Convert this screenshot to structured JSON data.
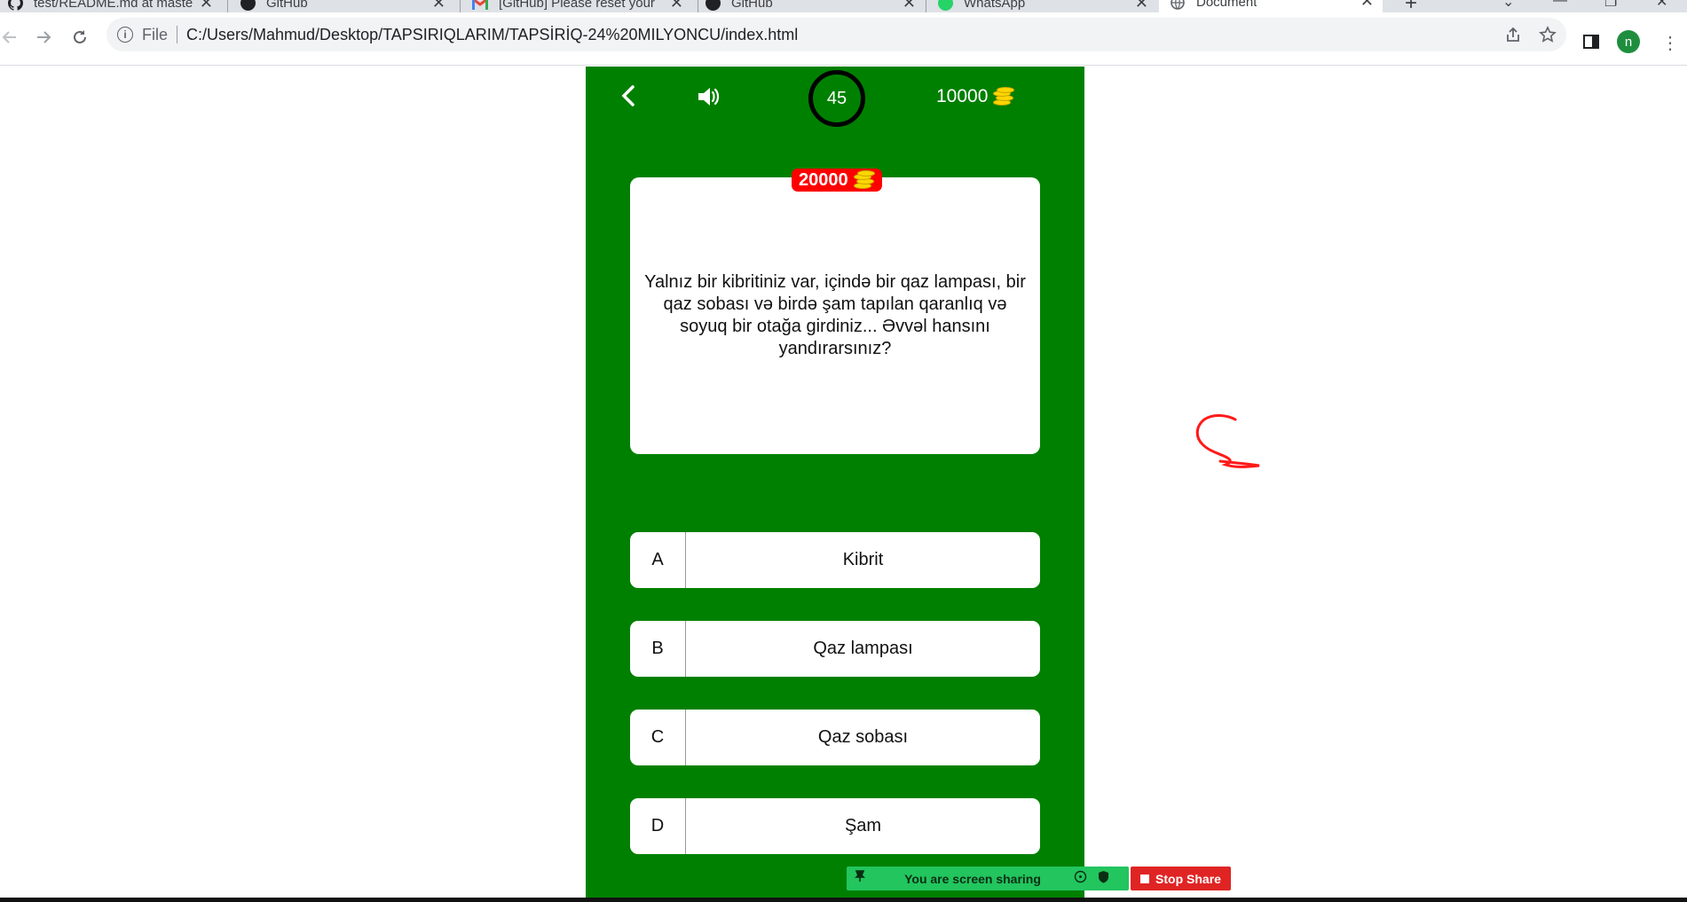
{
  "browser": {
    "tabs": [
      {
        "title": "test/README.md at master",
        "icon": "github-icon"
      },
      {
        "title": "GitHub",
        "icon": "github-icon"
      },
      {
        "title": "[GitHub] Please reset your p",
        "icon": "gmail-icon"
      },
      {
        "title": "GitHub",
        "icon": "github-icon"
      },
      {
        "title": "WhatsApp",
        "icon": "whatsapp-icon"
      },
      {
        "title": "Document",
        "icon": "globe-icon",
        "active": true
      }
    ],
    "address": {
      "scheme_label": "File",
      "url": "C:/Users/Mahmud/Desktop/TAPSIRIQLARIM/TAPSİRİQ-24%20MILYONCU/index.html"
    },
    "profile_initial": "n"
  },
  "game": {
    "timer": "45",
    "score": "10000",
    "prize": "20000",
    "question": "Yalnız bir kibritiniz var, içində bir qaz lampası, bir qaz sobası və birdə şam tapılan qaranlıq və soyuq bir otağa girdiniz... Əvvəl hansını yandırarsınız?",
    "answers": [
      {
        "letter": "A",
        "text": "Kibrit"
      },
      {
        "letter": "B",
        "text": "Qaz lampası"
      },
      {
        "letter": "C",
        "text": "Qaz sobası"
      },
      {
        "letter": "D",
        "text": "Şam"
      }
    ],
    "colors": {
      "background": "#008000",
      "badge": "#ff0000",
      "coin": "#ffd600"
    }
  },
  "screen_share": {
    "status_text": "You are screen sharing",
    "stop_label": "Stop Share"
  }
}
